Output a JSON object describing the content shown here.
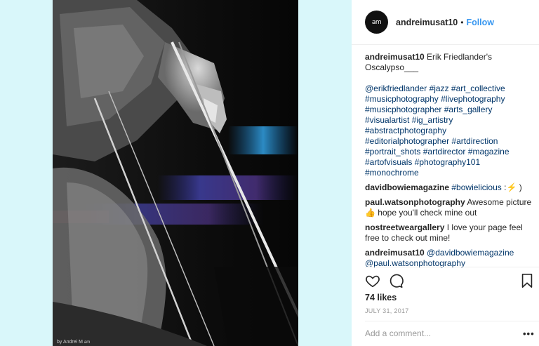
{
  "post": {
    "photo_credit": "by Andrei M",
    "photo_credit_mark": "am"
  },
  "header": {
    "username": "andreimusat10",
    "separator": "•",
    "follow_label": "Follow",
    "avatar_mark": "am"
  },
  "caption": {
    "username": "andreimusat10",
    "text": "Erik Friedlander's Oscalypso___",
    "mention": "@erikfriedlander",
    "hashtag_lines": [
      [
        "#jazz",
        "#art_collective"
      ],
      [
        "#musicphotography",
        "#livephotography"
      ],
      [
        "#musicphotographer",
        "#arts_gallery"
      ],
      [
        "#visualartist",
        "#ig_artistry"
      ],
      [
        "#abstractphotography"
      ],
      [
        "#editorialphotographer",
        "#artdirection"
      ],
      [
        "#portrait_shots",
        "#artdirector",
        "#magazine"
      ],
      [
        "#artofvisuals",
        "#photography101"
      ],
      [
        "#monochrome"
      ]
    ]
  },
  "comments": [
    {
      "username": "davidbowiemagazine",
      "tag": "#bowielicious",
      "text": ":",
      "emoji": "⚡",
      "suffix": ")"
    },
    {
      "username": "paul.watsonphotography",
      "text": "Awesome picture",
      "emoji": "👍",
      "suffix": "hope you'll check mine out"
    },
    {
      "username": "nostreetweargallery",
      "text": "I love your page feel free to check out mine!"
    },
    {
      "username": "andreimusat10",
      "mention1": "@davidbowiemagazine",
      "mention2": "@paul.watsonphotography"
    }
  ],
  "actions": {
    "like_icon": "heart-icon",
    "comment_icon": "comment-icon",
    "save_icon": "bookmark-icon"
  },
  "likes": "74 likes",
  "date": "JULY 31, 2017",
  "comment_box": {
    "placeholder": "Add a comment...",
    "more_label": "•••"
  }
}
